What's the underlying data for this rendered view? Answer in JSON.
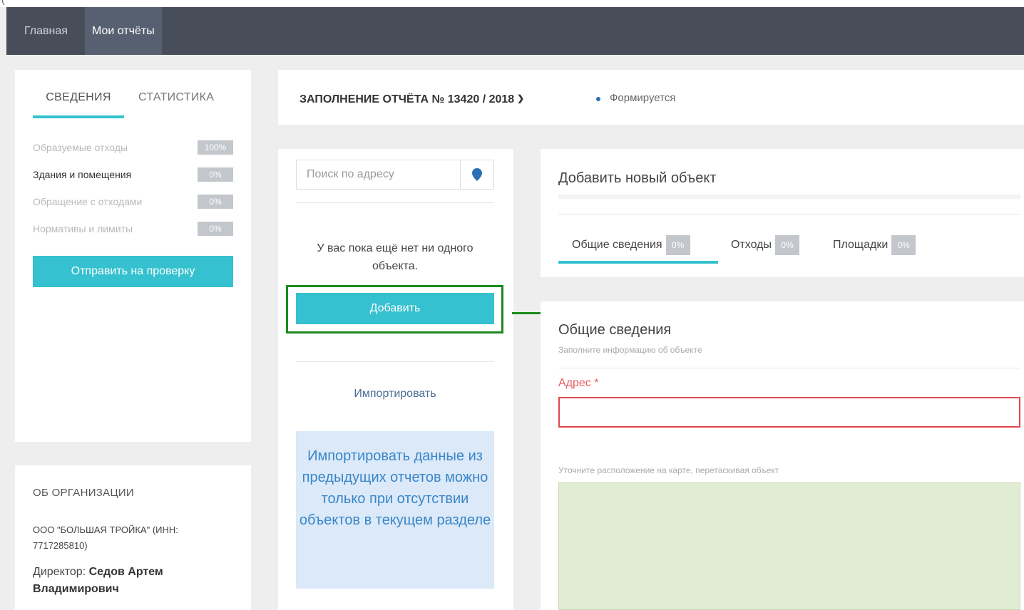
{
  "nav": {
    "home": "Главная",
    "my_reports": "Мои отчёты"
  },
  "left_panel": {
    "tabs": [
      {
        "label": "СВЕДЕНИЯ",
        "active": true
      },
      {
        "label": "СТАТИСТИКА",
        "active": false
      }
    ],
    "progress_items": [
      {
        "label": "Образуемые отходы",
        "percent": "100%"
      },
      {
        "label": "Здания и помещения",
        "percent": "0%"
      },
      {
        "label": "Обращение с отходами",
        "percent": "0%"
      },
      {
        "label": "Нормативы и лимиты",
        "percent": "0%"
      }
    ],
    "send_button": "Отправить на проверку"
  },
  "org": {
    "title": "ОБ ОРГАНИЗАЦИИ",
    "name": "ООО \"БОЛЬШАЯ ТРОЙКА\" (ИНН: 7717285810)",
    "director_label": "Директор:",
    "director_name": "Седов Артем Владимирович"
  },
  "header": {
    "report_title": "ЗАПОЛНЕНИЕ ОТЧЁТА № 13420 / 2018",
    "status": "Формируется"
  },
  "objects_panel": {
    "search_placeholder": "Поиск по адресу",
    "empty_message": "У вас пока ещё нет ни одного объекта.",
    "add_button": "Добавить",
    "import_link": "Импортировать",
    "import_note": "Импортировать данные из предыдущих отчетов можно только при отсутствии объектов в текущем разделе"
  },
  "add_object": {
    "title": "Добавить новый объект",
    "tabs": [
      {
        "label": "Общие сведения",
        "percent": "0%",
        "active": true
      },
      {
        "label": "Отходы",
        "percent": "0%",
        "active": false
      },
      {
        "label": "Площадки",
        "percent": "0%",
        "active": false
      }
    ]
  },
  "form": {
    "title": "Общие сведения",
    "subtitle": "Заполните информацию об объекте",
    "address_label": "Адрес",
    "required_mark": "*",
    "address_value": "",
    "map_hint": "Уточните расположение на карте, перетаскивая объект"
  },
  "colors": {
    "accent": "#35c1cf",
    "nav_bg": "#474e59",
    "highlight": "#1c8a1c",
    "error": "#e0484f",
    "status_dot": "#2c6fb7",
    "map_bg": "#e0ecd3"
  }
}
